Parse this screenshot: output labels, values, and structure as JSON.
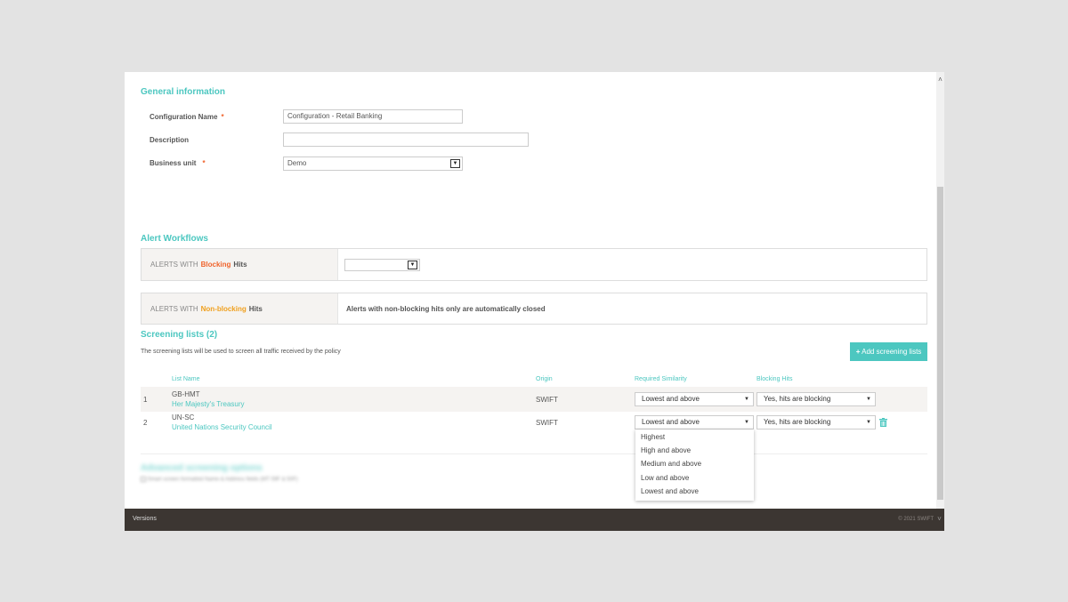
{
  "general": {
    "title": "General information",
    "config_name_label": "Configuration Name",
    "config_name_value": "Configuration - Retail Banking",
    "description_label": "Description",
    "description_value": "",
    "business_unit_label": "Business unit",
    "business_unit_value": "Demo",
    "required_mark": "*"
  },
  "alerts": {
    "title": "Alert Workflows",
    "blocking_prefix": "ALERTS WITH",
    "blocking_word": "Blocking",
    "blocking_suffix": "Hits",
    "blocking_select_value": "",
    "nonblocking_prefix": "ALERTS WITH",
    "nonblocking_word": "Non-blocking",
    "nonblocking_suffix": "Hits",
    "nonblocking_text": "Alerts with non-blocking hits only are automatically closed"
  },
  "screening": {
    "title": "Screening lists (2)",
    "description": "The screening lists will be used to screen all traffic received by the policy",
    "add_button": "Add screening lists",
    "columns": {
      "list_name": "List Name",
      "origin": "Origin",
      "similarity": "Required Similarity",
      "blocking": "Blocking Hits"
    },
    "rows": [
      {
        "index": "1",
        "code": "GB-HMT",
        "name": "Her Majesty's Treasury",
        "origin": "SWIFT",
        "similarity": "Lowest and above",
        "blocking": "Yes, hits are blocking"
      },
      {
        "index": "2",
        "code": "UN-SC",
        "name": "United Nations Security Council",
        "origin": "SWIFT",
        "similarity": "Lowest and above",
        "blocking": "Yes, hits are blocking"
      }
    ],
    "similarity_options": [
      "Highest",
      "High and above",
      "Medium and above",
      "Low and above",
      "Lowest and above"
    ]
  },
  "advanced": {
    "title": "Advanced screening options",
    "option": "Smart screen formatted Name & Address fields (MT 59F & 50F)"
  },
  "footer": {
    "versions": "Versions",
    "copyright": "© 2021 SWIFT"
  },
  "colors": {
    "accent": "#4cc7c0",
    "required": "#f0642d",
    "blocking": "#f0642d",
    "nonblocking": "#f0a01e",
    "footer": "#3c3632"
  },
  "icons": {
    "add": "plus-icon",
    "delete": "trash-icon",
    "scroll_up": "chevron-up-icon",
    "scroll_down": "chevron-down-icon"
  }
}
